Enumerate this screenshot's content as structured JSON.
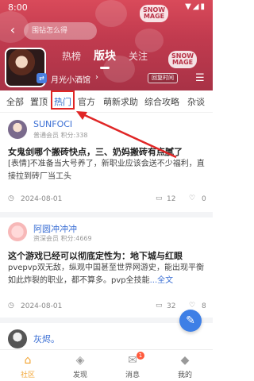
{
  "status_bar": {
    "time": "8:00",
    "icons": "▼◢▮"
  },
  "header": {
    "search_placeholder": "围钻怎么得",
    "tabs": [
      {
        "label": "热榜"
      },
      {
        "label": "版块"
      },
      {
        "label": "关注"
      }
    ],
    "active_tab": "版块",
    "sub_board_name": "月光小酒馆",
    "return_button": "回复时间"
  },
  "category_tabs": [
    {
      "label": "全部"
    },
    {
      "label": "置顶"
    },
    {
      "label": "热门"
    },
    {
      "label": "官方"
    },
    {
      "label": "萌新求助"
    },
    {
      "label": "综合攻略"
    },
    {
      "label": "杂谈"
    }
  ],
  "active_category": "热门",
  "posts": [
    {
      "author": "SUNFOCI",
      "meta": "普通会员 积分:338",
      "title": "女鬼剑哪个搬砖快点，三、奶妈搬砖有点腻了",
      "body": "[表情]不准备当大号养了，新职业应该会送不少福利，直接拉到砖厂当工头",
      "date": "2024-08-01",
      "comments": "12",
      "likes": "0"
    },
    {
      "author": "阿圆冲冲冲",
      "meta": "资深会员 积分:4669",
      "title": "这个游戏已经可以彻底定性为：地下城与红眼",
      "body": "pvepvp双无敌，纵观中国甚至世界网游史，能出现平衡如此炸裂的职业，都不算多。pvp全技能",
      "more": "...全文",
      "date": "2024-08-01",
      "comments": "32",
      "likes": "8"
    },
    {
      "author": "灰烬。"
    }
  ],
  "bottom_nav": [
    {
      "label": "社区"
    },
    {
      "label": "发现"
    },
    {
      "label": "消息",
      "badge": "1"
    },
    {
      "label": "我的"
    }
  ],
  "colors": {
    "accent": "#3b6fd4",
    "active_nav": "#f2a431",
    "highlight_box": "#e02626"
  }
}
